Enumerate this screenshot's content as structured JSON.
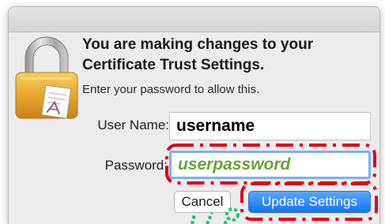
{
  "dialog": {
    "headline_line1": "You are making changes to your",
    "headline_line2": "Certificate Trust Settings.",
    "subtext": "Enter your password to allow this.",
    "icon": "padlock-icon"
  },
  "form": {
    "username_label": "User Name:",
    "username_value": "username",
    "password_label": "Password:",
    "password_value": "userpassword"
  },
  "buttons": {
    "cancel_label": "Cancel",
    "update_label": "Update Settings"
  },
  "colors": {
    "primary_button": "#1673f0",
    "focus_ring": "#7faef0",
    "annotation_red": "#e0001b",
    "annotation_green": "#1fc07a",
    "password_text": "#6aa03c"
  }
}
